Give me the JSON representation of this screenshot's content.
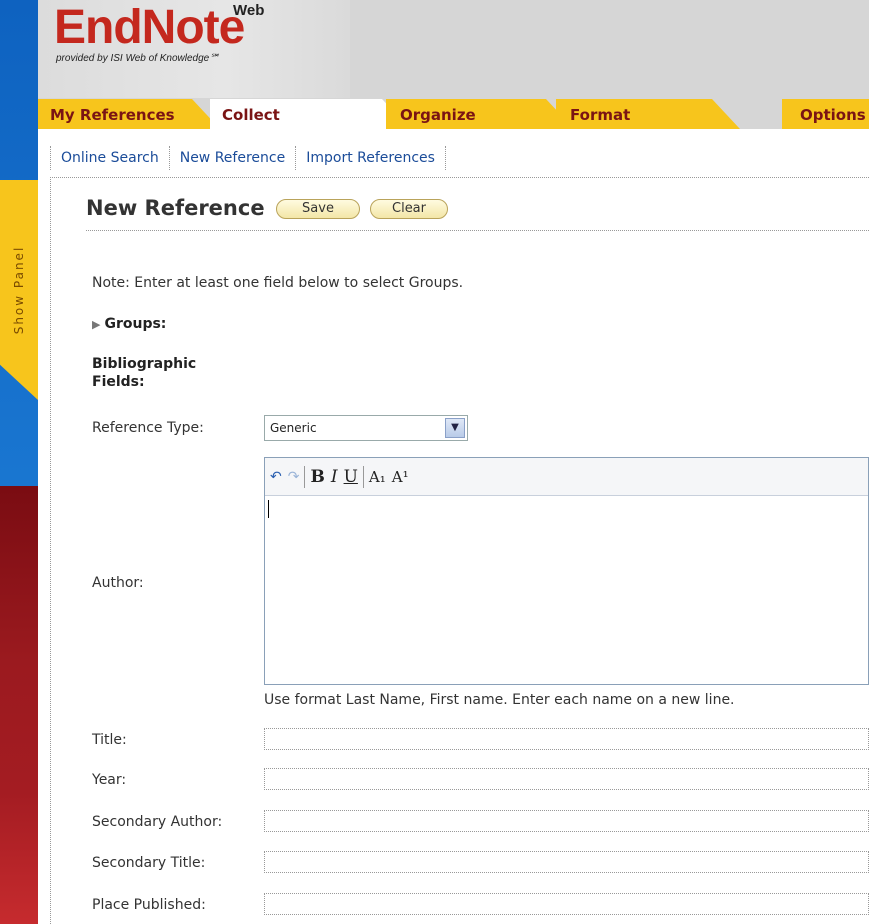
{
  "logo": {
    "main": "EndNote",
    "sup": "Web",
    "sub": "provided by ISI Web of Knowledge℠"
  },
  "tabs": [
    {
      "label": "My References"
    },
    {
      "label": "Collect"
    },
    {
      "label": "Organize"
    },
    {
      "label": "Format"
    },
    {
      "label": "Options"
    }
  ],
  "subnav": [
    {
      "label": "Online Search"
    },
    {
      "label": "New Reference"
    },
    {
      "label": "Import References"
    }
  ],
  "side_panel": {
    "label": "Show Panel"
  },
  "page": {
    "title": "New Reference",
    "save_label": "Save",
    "clear_label": "Clear",
    "note": "Note: Enter at least one field below to select Groups.",
    "groups_label": "Groups:",
    "bib_line1": "Bibliographic",
    "bib_line2": "Fields:"
  },
  "form": {
    "reference_type_label": "Reference Type:",
    "reference_type_value": "Generic",
    "author_label": "Author:",
    "author_hint": "Use format Last Name, First name. Enter each name on a new line.",
    "title_label": "Title:",
    "year_label": "Year:",
    "secondary_author_label": "Secondary Author:",
    "secondary_title_label": "Secondary Title:",
    "place_published_label": "Place Published:"
  },
  "toolbar": {
    "undo": "↶",
    "redo": "↷",
    "bold": "B",
    "italic": "I",
    "underline": "U",
    "subscript": "A₁",
    "superscript": "A¹"
  }
}
